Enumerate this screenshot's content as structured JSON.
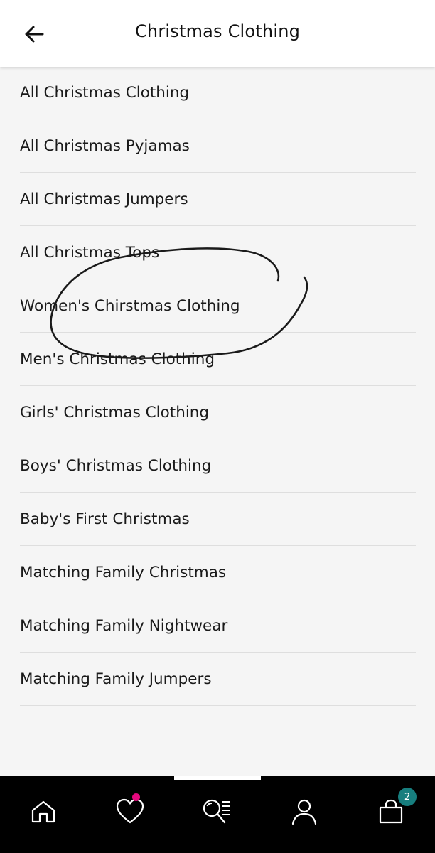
{
  "header": {
    "title": "Christmas Clothing",
    "back_icon": "arrow-left-icon"
  },
  "menu": {
    "items": [
      {
        "label": "All Christmas Clothing"
      },
      {
        "label": "All Christmas Pyjamas"
      },
      {
        "label": "All Christmas Jumpers"
      },
      {
        "label": "All Christmas Tops"
      },
      {
        "label": "Women's Chirstmas Clothing"
      },
      {
        "label": "Men's Christmas Clothing"
      },
      {
        "label": "Girls' Christmas Clothing"
      },
      {
        "label": "Boys' Christmas Clothing"
      },
      {
        "label": "Baby's First Christmas"
      },
      {
        "label": "Matching Family Christmas"
      },
      {
        "label": "Matching Family Nightwear"
      },
      {
        "label": "Matching Family Jumpers"
      }
    ]
  },
  "bottom_nav": {
    "items": [
      {
        "icon": "home-icon"
      },
      {
        "icon": "heart-icon",
        "has_indicator": true
      },
      {
        "icon": "search-list-icon"
      },
      {
        "icon": "user-icon"
      },
      {
        "icon": "shopping-bag-icon"
      }
    ],
    "bag_count": "2"
  },
  "colors": {
    "wishlist_dot": "#e5087e",
    "bag_badge": "#177e7e",
    "nav_background": "#000000",
    "page_background": "#f5f5f5"
  }
}
